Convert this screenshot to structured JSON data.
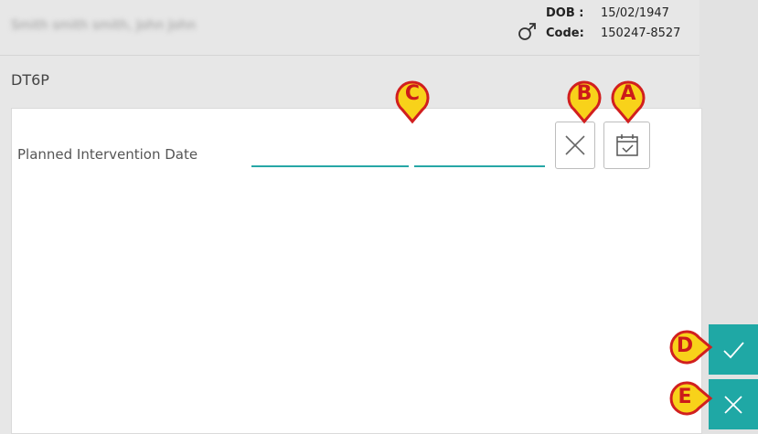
{
  "patient": {
    "name": "Smith smith smith, John John",
    "dob_label": "DOB :",
    "dob": "15/02/1947",
    "code_label": "Code:",
    "code": "150247-8527",
    "gender_icon": "male-icon"
  },
  "form": {
    "title": "DT6P",
    "field_label": "Planned Intervention Date",
    "date_value": "",
    "time_value": ""
  },
  "buttons": {
    "clear_icon": "close-icon",
    "calendar_icon": "calendar-check-icon",
    "confirm_icon": "check-icon",
    "cancel_icon": "close-icon"
  },
  "callouts": [
    {
      "letter": "A"
    },
    {
      "letter": "B"
    },
    {
      "letter": "C"
    },
    {
      "letter": "D"
    },
    {
      "letter": "E"
    }
  ],
  "colors": {
    "accent": "#1fa8a5",
    "underline": "#26a7a6",
    "callout_fill": "#f8d21a",
    "callout_border": "#d11f1f",
    "callout_text": "#cc1a1a"
  }
}
